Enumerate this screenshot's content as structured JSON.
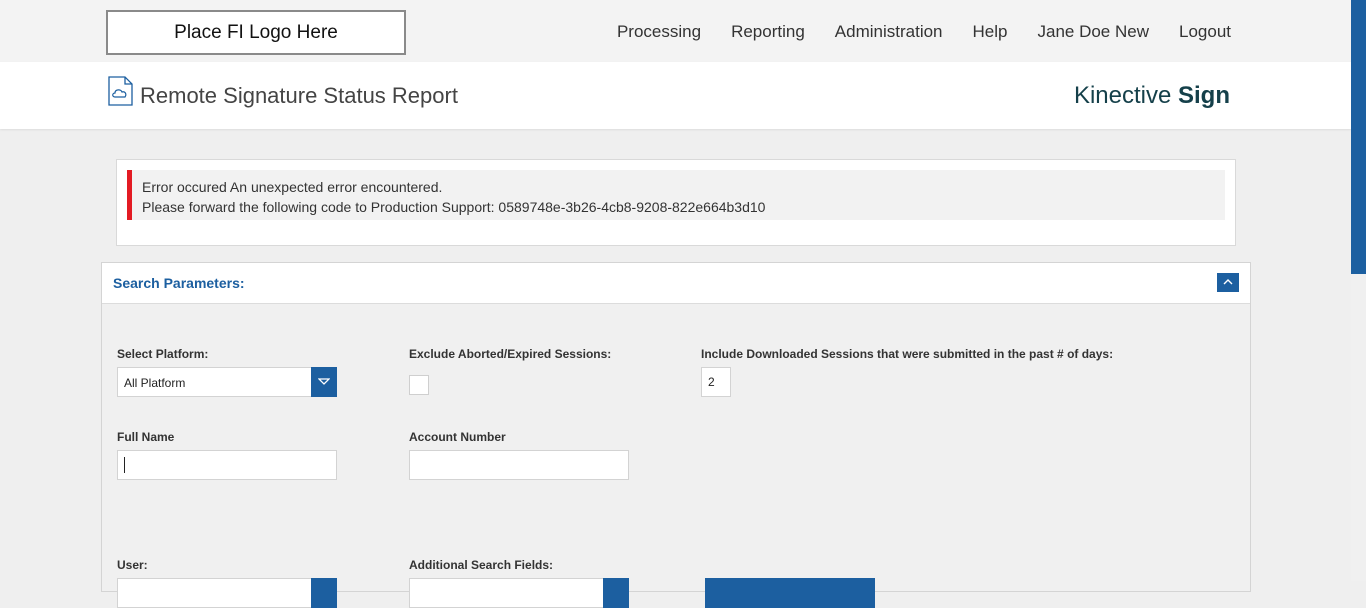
{
  "header": {
    "logo_text": "Place FI Logo Here",
    "nav": [
      {
        "label": "Processing"
      },
      {
        "label": "Reporting"
      },
      {
        "label": "Administration"
      },
      {
        "label": "Help"
      },
      {
        "label": "Jane Doe New"
      },
      {
        "label": "Logout"
      }
    ]
  },
  "titlebar": {
    "page_title": "Remote Signature Status Report",
    "brand_light": "Kinective ",
    "brand_bold": "Sign",
    "icon": "document-cloud-icon"
  },
  "error": {
    "line1": "Error occured An unexpected error encountered.",
    "line2": "Please forward the following code to Production Support: 0589748e-3b26-4cb8-9208-822e664b3d10",
    "accent_color": "#e31b23"
  },
  "search": {
    "title": "Search Parameters:",
    "platform_label": "Select Platform:",
    "platform_value": "All Platform",
    "exclude_label": "Exclude Aborted/Expired Sessions:",
    "exclude_checked": false,
    "include_label": "Include Downloaded Sessions that were submitted in the past # of days:",
    "include_value": "2",
    "fullname_label": "Full Name",
    "fullname_value": "",
    "account_label": "Account Number",
    "account_value": "",
    "user_label": "User:",
    "additional_label": "Additional Search Fields:"
  },
  "colors": {
    "primary": "#1c5fa0",
    "brand_text": "#15404a"
  }
}
